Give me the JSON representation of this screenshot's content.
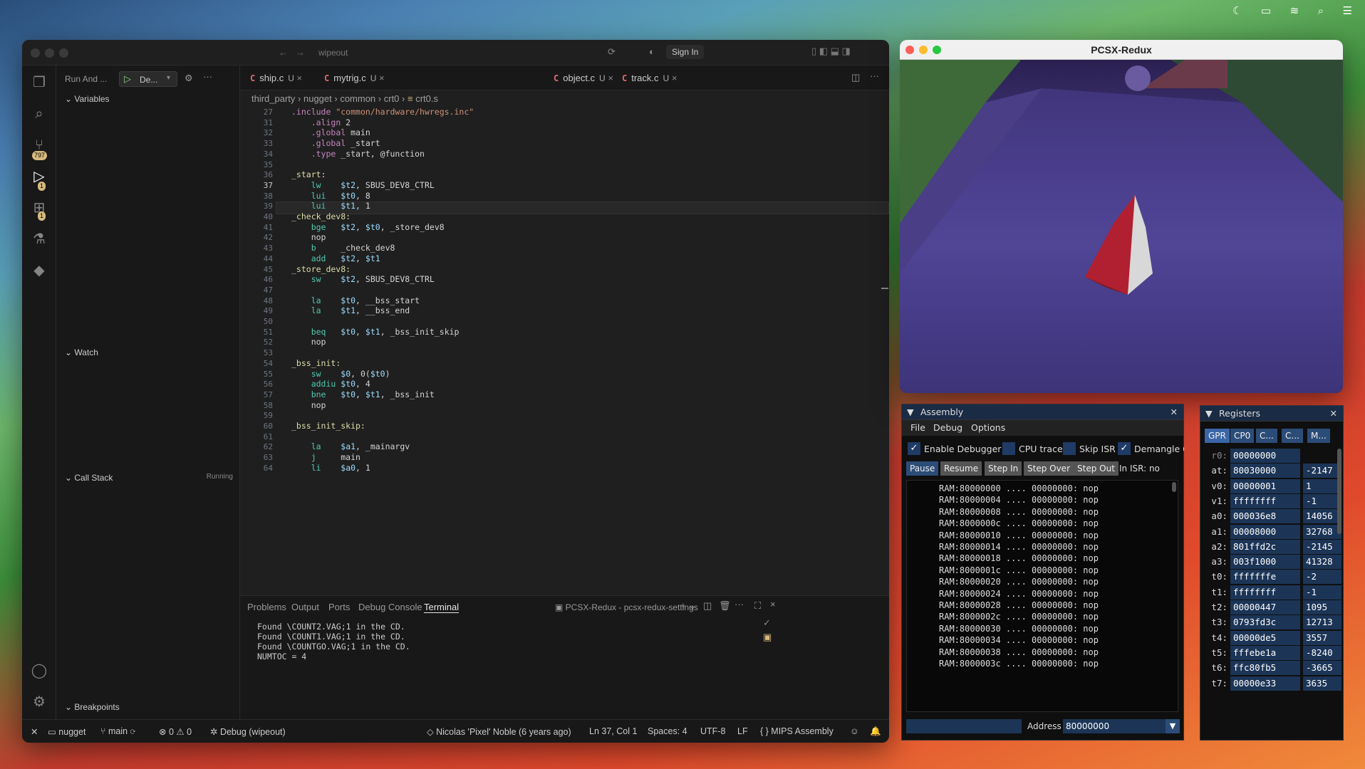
{
  "menubar": {
    "apple": "",
    "icons": [
      "moon-icon",
      "battery-icon",
      "wifi-icon",
      "search-icon",
      "control-center-icon"
    ]
  },
  "vscode": {
    "title": "wipeout",
    "sign_in": "Sign In",
    "run_and": "Run And ...",
    "config": "De...",
    "sections": {
      "variables": "Variables",
      "watch": "Watch",
      "call_stack": "Call Stack",
      "running": "Running",
      "breakpoints": "Breakpoints"
    },
    "badges": {
      "scm": "797",
      "debug": "1",
      "ext": "1"
    },
    "tabs": [
      {
        "name": "ship.c",
        "status": "U"
      },
      {
        "name": "mytrig.c",
        "status": "U"
      },
      {
        "name": "object.c",
        "status": "U"
      },
      {
        "name": "track.c",
        "status": "U"
      }
    ],
    "breadcrumb": [
      "third_party",
      "nugget",
      "common",
      "crt0",
      "crt0.s"
    ],
    "code": [
      {
        "n": "27",
        "t": ".include \"common/hardware/hwregs.inc\""
      },
      {
        "n": "31",
        "t": "    .align 2"
      },
      {
        "n": "32",
        "t": "    .global main"
      },
      {
        "n": "33",
        "t": "    .global _start"
      },
      {
        "n": "34",
        "t": "    .type _start, @function"
      },
      {
        "n": "35",
        "t": ""
      },
      {
        "n": "36",
        "t": "_start:"
      },
      {
        "n": "37",
        "t": "    lw    $t2, SBUS_DEV8_CTRL"
      },
      {
        "n": "38",
        "t": "    lui   $t0, 8"
      },
      {
        "n": "39",
        "t": "    lui   $t1, 1"
      },
      {
        "n": "40",
        "t": "_check_dev8:"
      },
      {
        "n": "41",
        "t": "    bge   $t2, $t0, _store_dev8"
      },
      {
        "n": "42",
        "t": "    nop"
      },
      {
        "n": "43",
        "t": "    b     _check_dev8"
      },
      {
        "n": "44",
        "t": "    add   $t2, $t1"
      },
      {
        "n": "45",
        "t": "_store_dev8:"
      },
      {
        "n": "46",
        "t": "    sw    $t2, SBUS_DEV8_CTRL"
      },
      {
        "n": "47",
        "t": ""
      },
      {
        "n": "48",
        "t": "    la    $t0, __bss_start"
      },
      {
        "n": "49",
        "t": "    la    $t1, __bss_end"
      },
      {
        "n": "50",
        "t": ""
      },
      {
        "n": "51",
        "t": "    beq   $t0, $t1, _bss_init_skip"
      },
      {
        "n": "52",
        "t": "    nop"
      },
      {
        "n": "53",
        "t": ""
      },
      {
        "n": "54",
        "t": "_bss_init:"
      },
      {
        "n": "55",
        "t": "    sw    $0, 0($t0)"
      },
      {
        "n": "56",
        "t": "    addiu $t0, 4"
      },
      {
        "n": "57",
        "t": "    bne   $t0, $t1, _bss_init"
      },
      {
        "n": "58",
        "t": "    nop"
      },
      {
        "n": "59",
        "t": ""
      },
      {
        "n": "60",
        "t": "_bss_init_skip:"
      },
      {
        "n": "61",
        "t": ""
      },
      {
        "n": "62",
        "t": "    la    $a1, _mainargv"
      },
      {
        "n": "63",
        "t": "    j     main"
      },
      {
        "n": "64",
        "t": "    li    $a0, 1"
      }
    ],
    "panel_tabs": [
      "Problems",
      "Output",
      "Ports",
      "Debug Console",
      "Terminal"
    ],
    "terminal_name": "PCSX-Redux - pcsx-redux-settings",
    "terminal": [
      "Found \\COUNT2.VAG;1 in the CD.",
      "Found \\COUNT1.VAG;1 in the CD.",
      "Found \\COUNTGO.VAG;1 in the CD.",
      "NUMTOC = 4"
    ],
    "status": {
      "repo": "nugget",
      "branch": "main",
      "errors": "0",
      "warnings": "0",
      "debug": "Debug (wipeout)",
      "blame": "Nicolas 'Pixel' Noble (6 years ago)",
      "pos": "Ln 37, Col 1",
      "spaces": "Spaces: 4",
      "enc": "UTF-8",
      "eol": "LF",
      "lang": "MIPS Assembly"
    }
  },
  "pcsx": {
    "title": "PCSX-Redux"
  },
  "assembly": {
    "title": "Assembly",
    "menu": [
      "File",
      "Debug",
      "Options"
    ],
    "checks": [
      {
        "label": "Enable Debugger",
        "on": true
      },
      {
        "label": "CPU trace",
        "on": false
      },
      {
        "label": "Skip ISR",
        "on": false
      },
      {
        "label": "Demangle C",
        "on": true
      }
    ],
    "buttons": [
      "Pause",
      "Resume",
      "Step In",
      "Step Over",
      "Step Out"
    ],
    "isr": "In ISR: no",
    "lines": [
      "RAM:80000000 .... 00000000: nop",
      "RAM:80000004 .... 00000000: nop",
      "RAM:80000008 .... 00000000: nop",
      "RAM:8000000c .... 00000000: nop",
      "RAM:80000010 .... 00000000: nop",
      "RAM:80000014 .... 00000000: nop",
      "RAM:80000018 .... 00000000: nop",
      "RAM:8000001c .... 00000000: nop",
      "RAM:80000020 .... 00000000: nop",
      "RAM:80000024 .... 00000000: nop",
      "RAM:80000028 .... 00000000: nop",
      "RAM:8000002c .... 00000000: nop",
      "RAM:80000030 .... 00000000: nop",
      "RAM:80000034 .... 00000000: nop",
      "RAM:80000038 .... 00000000: nop",
      "RAM:8000003c .... 00000000: nop"
    ],
    "address_label": "Address",
    "address": "80000000"
  },
  "registers": {
    "title": "Registers",
    "tabs": [
      "GPR",
      "CP0",
      "C...",
      "C...",
      "M..."
    ],
    "rows": [
      {
        "n": "r0:",
        "h": "00000000",
        "d": ""
      },
      {
        "n": "at:",
        "h": "80030000",
        "d": "-2147"
      },
      {
        "n": "v0:",
        "h": "00000001",
        "d": "1"
      },
      {
        "n": "v1:",
        "h": "ffffffff",
        "d": "-1"
      },
      {
        "n": "a0:",
        "h": "000036e8",
        "d": "14056"
      },
      {
        "n": "a1:",
        "h": "00008000",
        "d": "32768"
      },
      {
        "n": "a2:",
        "h": "801ffd2c",
        "d": "-2145"
      },
      {
        "n": "a3:",
        "h": "003f1000",
        "d": "41328"
      },
      {
        "n": "t0:",
        "h": "fffffffe",
        "d": "-2"
      },
      {
        "n": "t1:",
        "h": "ffffffff",
        "d": "-1"
      },
      {
        "n": "t2:",
        "h": "00000447",
        "d": "1095"
      },
      {
        "n": "t3:",
        "h": "0793fd3c",
        "d": "12713"
      },
      {
        "n": "t4:",
        "h": "00000de5",
        "d": "3557"
      },
      {
        "n": "t5:",
        "h": "fffebe1a",
        "d": "-8240"
      },
      {
        "n": "t6:",
        "h": "ffc80fb5",
        "d": "-3665"
      },
      {
        "n": "t7:",
        "h": "00000e33",
        "d": "3635"
      }
    ]
  }
}
